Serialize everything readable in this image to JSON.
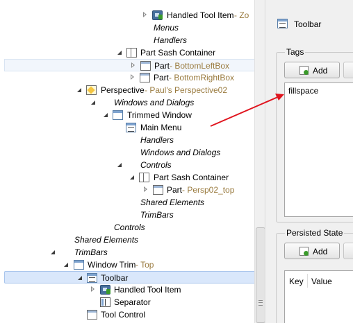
{
  "tree": {
    "rows": [
      {
        "label": "Handled Tool Item",
        "suffix": " - Zo"
      },
      {
        "label": "Menus"
      },
      {
        "label": "Handlers"
      },
      {
        "label": "Part Sash Container"
      },
      {
        "label": "Part",
        "suffix": " - BottomLeftBox"
      },
      {
        "label": "Part",
        "suffix": " - BottomRightBox"
      },
      {
        "label": "Perspective",
        "suffix": " - Paul's Perspective02"
      },
      {
        "label": "Windows and Dialogs"
      },
      {
        "label": "Trimmed Window"
      },
      {
        "label": "Main Menu"
      },
      {
        "label": "Handlers"
      },
      {
        "label": "Windows and Dialogs"
      },
      {
        "label": "Controls"
      },
      {
        "label": "Part Sash Container"
      },
      {
        "label": "Part",
        "suffix": " - Persp02_top"
      },
      {
        "label": "Shared Elements"
      },
      {
        "label": "TrimBars"
      },
      {
        "label": "Controls"
      },
      {
        "label": "Shared Elements"
      },
      {
        "label": "TrimBars"
      },
      {
        "label": "Window Trim",
        "suffix": " - Top"
      },
      {
        "label": "Toolbar"
      },
      {
        "label": "Handled Tool Item"
      },
      {
        "label": "Separator"
      },
      {
        "label": "Tool Control"
      }
    ]
  },
  "details": {
    "title": "Toolbar",
    "tags": {
      "group_label": "Tags",
      "add_label": "Add",
      "values": [
        "fillspace"
      ]
    },
    "persisted_state": {
      "group_label": "Persisted State",
      "add_label": "Add",
      "columns": [
        "Key",
        "Value"
      ]
    }
  },
  "colors": {
    "selection": "#d9e7fb",
    "suffix_text": "#9a7b3f",
    "annotation_arrow": "#e0141e"
  }
}
